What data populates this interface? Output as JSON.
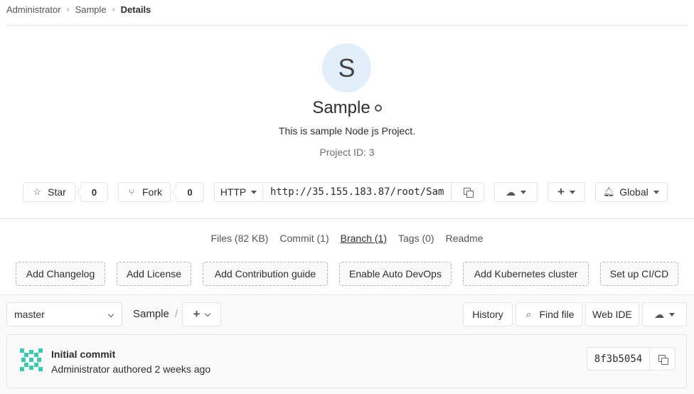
{
  "breadcrumb": {
    "items": [
      "Administrator",
      "Sample"
    ],
    "current": "Details"
  },
  "project": {
    "avatar_letter": "S",
    "name": "Sample",
    "description": "This is sample Node js Project.",
    "id_text": "Project ID: 3"
  },
  "actions": {
    "star_label": "Star",
    "star_count": "0",
    "fork_label": "Fork",
    "fork_count": "0",
    "protocol": "HTTP",
    "clone_url": "http://35.155.183.87/root/Sam",
    "notification_label": "Global"
  },
  "stats": {
    "files": "Files (82 KB)",
    "commits": "Commit (1)",
    "branches": "Branch (1)",
    "tags": "Tags (0)",
    "readme": "Readme"
  },
  "quick_actions": [
    "Add Changelog",
    "Add License",
    "Add Contribution guide",
    "Enable Auto DevOps",
    "Add Kubernetes cluster",
    "Set up CI/CD"
  ],
  "tree": {
    "branch": "master",
    "path_root": "Sample",
    "path_sep": "/",
    "history_label": "History",
    "find_file_label": "Find file",
    "web_ide_label": "Web IDE"
  },
  "last_commit": {
    "title": "Initial commit",
    "meta": "Administrator authored 2 weeks ago",
    "sha": "8f3b5054"
  },
  "icons": {
    "star": "star-icon",
    "fork": "fork-icon",
    "copy": "copy-icon",
    "download": "download-icon",
    "plus": "plus-icon",
    "bell": "bell-icon",
    "search": "search-icon",
    "globe": "globe-icon"
  },
  "colors": {
    "avatar_bg": "#e1effa",
    "commit_avatar": "#3dc9b0",
    "border": "#e5e5e5"
  }
}
